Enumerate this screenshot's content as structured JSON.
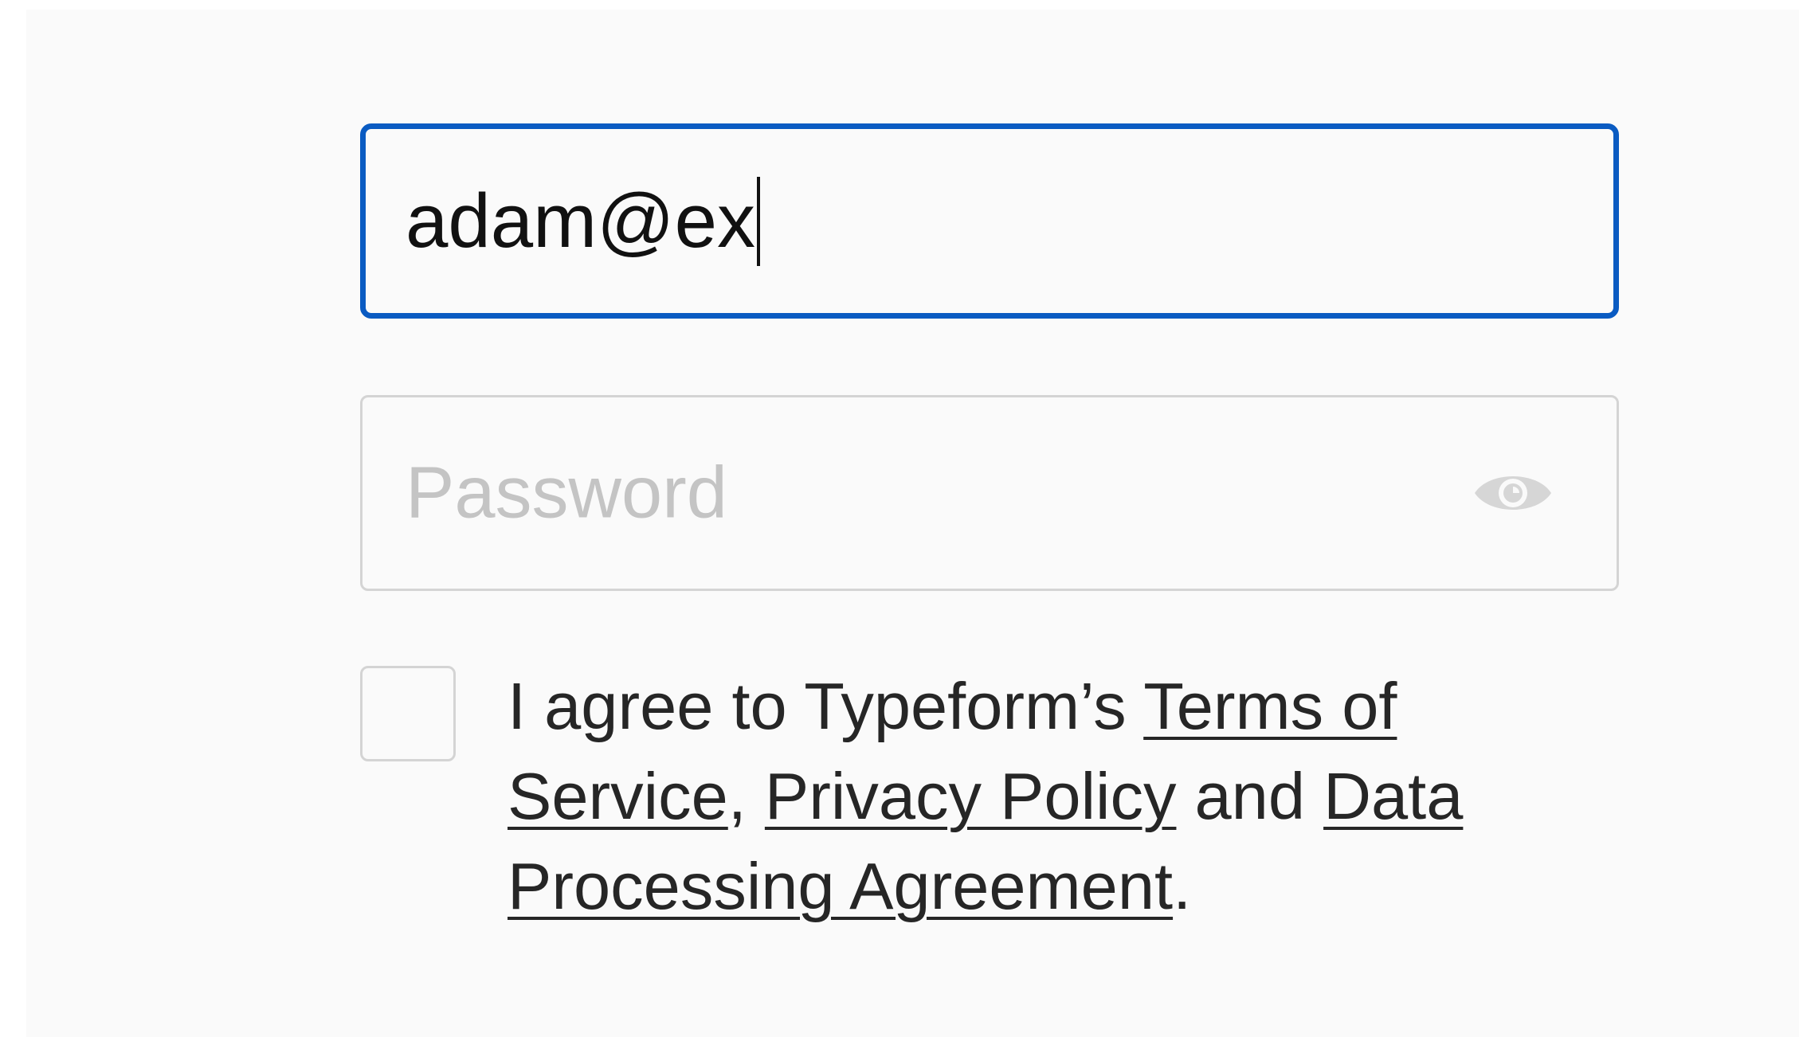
{
  "form": {
    "email": {
      "value": "adam@ex"
    },
    "password": {
      "placeholder": "Password",
      "visibility_icon": "eye-icon"
    },
    "consent": {
      "checked": false,
      "prefix": "I agree to Typeform’s ",
      "terms_link": "Terms of Service",
      "comma": ", ",
      "privacy_link": "Privacy Policy",
      "and_text": " and ",
      "dpa_link": "Data Processing Agreement",
      "period": "."
    }
  },
  "colors": {
    "focus_border": "#0a5bc2",
    "field_border": "#d4d4d4",
    "placeholder_text": "#c4c4c4",
    "background": "#fafafa"
  }
}
